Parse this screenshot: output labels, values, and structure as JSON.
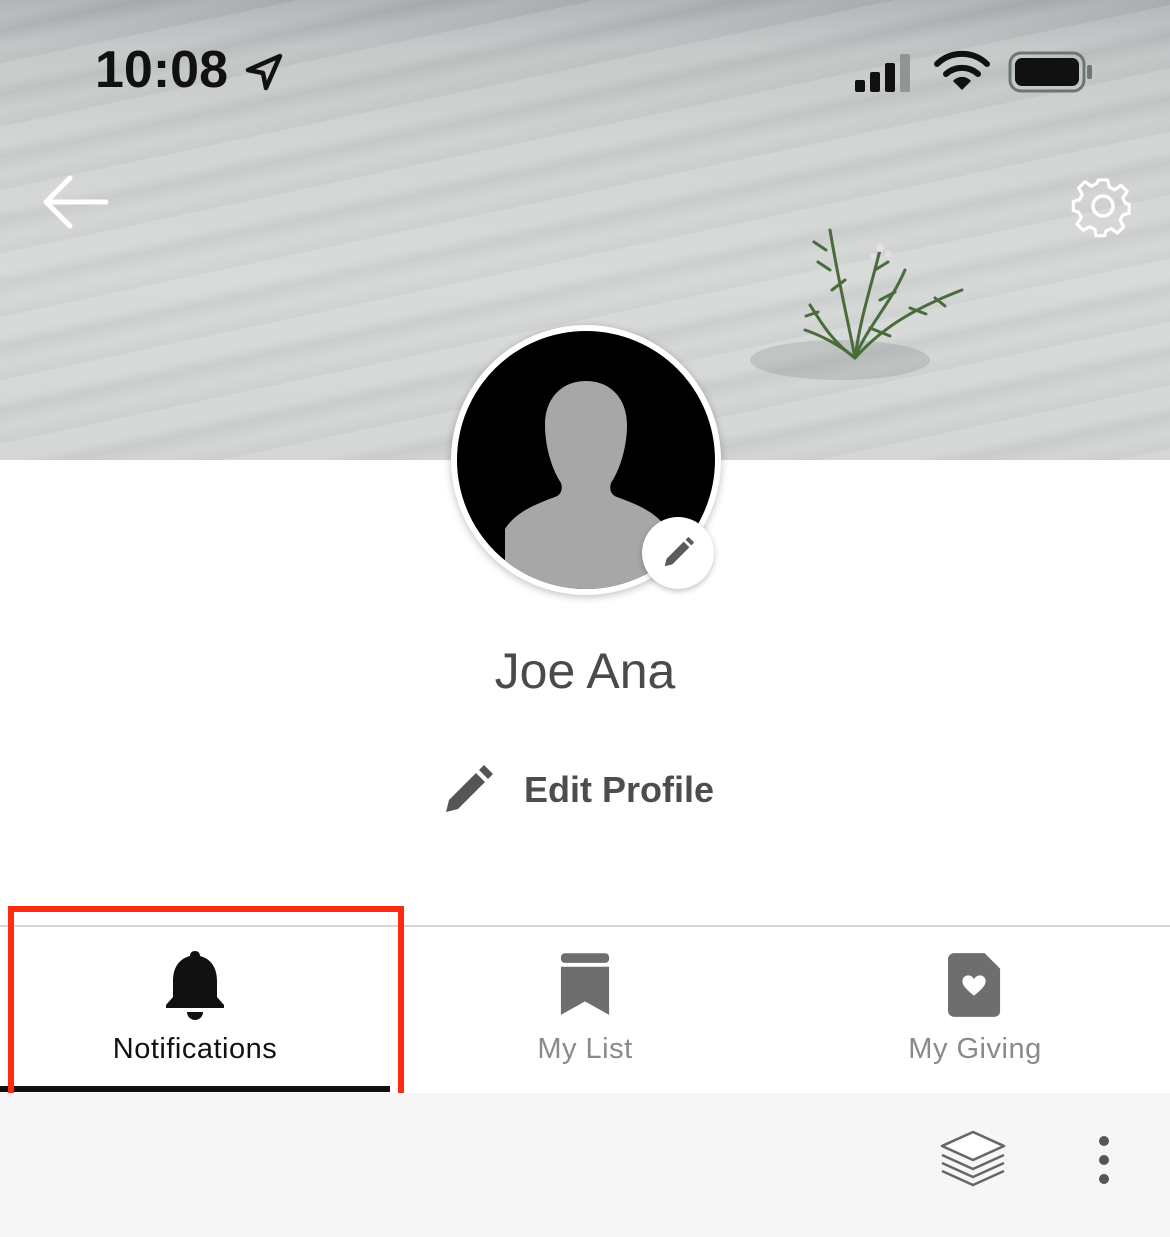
{
  "status_bar": {
    "time": "10:08",
    "icons": [
      "location-arrow-icon",
      "cellular-signal-icon",
      "wifi-icon",
      "battery-icon"
    ]
  },
  "header": {
    "back_icon": "arrow-left-icon",
    "settings_icon": "gear-icon",
    "cover_image": "sand-dune-with-plant"
  },
  "profile": {
    "name": "Joe Ana",
    "avatar_icon": "person-silhouette-icon",
    "avatar_edit_icon": "pencil-icon",
    "edit_profile_label": "Edit Profile",
    "edit_profile_icon": "pencil-icon"
  },
  "tabs": [
    {
      "label": "Notifications",
      "icon": "bell-icon",
      "active": true
    },
    {
      "label": "My List",
      "icon": "bookmark-icon",
      "active": false
    },
    {
      "label": "My Giving",
      "icon": "heart-document-icon",
      "active": false
    }
  ],
  "toolbar": {
    "icons": [
      "layers-icon",
      "more-vertical-icon"
    ]
  },
  "colors": {
    "highlight": "#ff2a12",
    "active_tab": "#111111",
    "inactive_tab": "#8a8a8a",
    "toolbar_bg": "#f6f6f6"
  }
}
